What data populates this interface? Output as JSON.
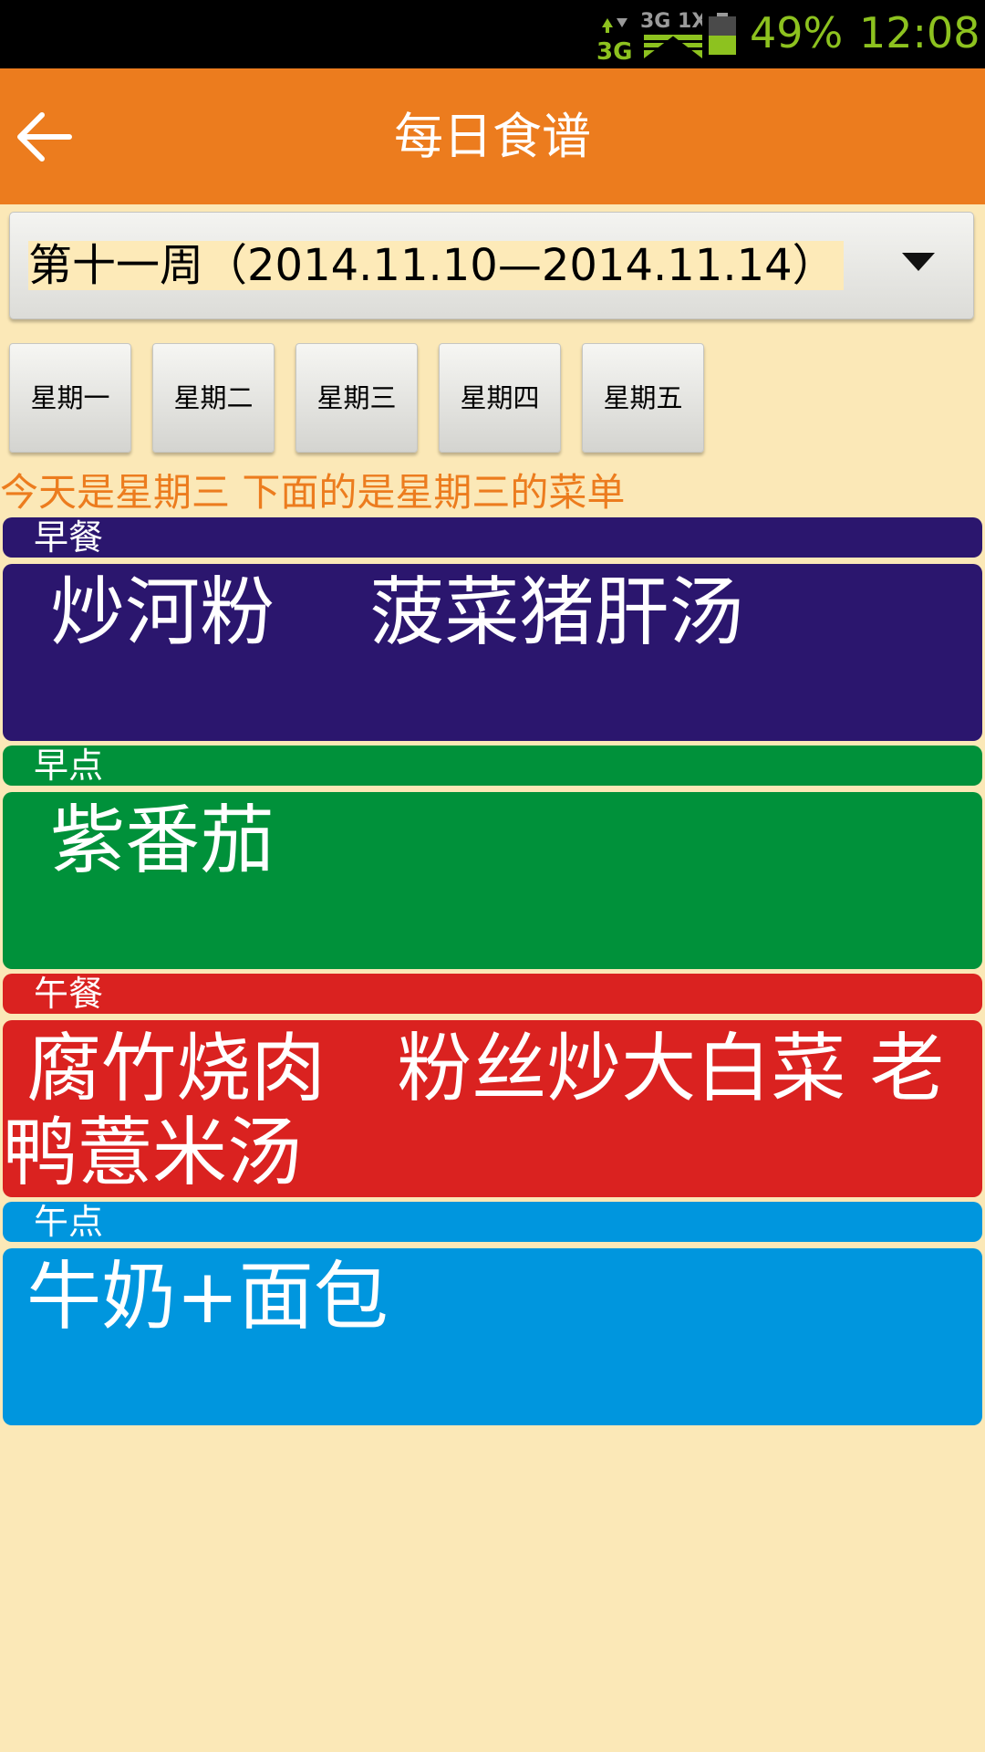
{
  "status_bar": {
    "network_label": "3G",
    "network_label_2": "3G 1X",
    "battery": "49%",
    "time": "12:08",
    "status_color": "#8DC21F"
  },
  "header": {
    "title": "每日食谱",
    "back_icon": "arrow-left-icon",
    "color": "#EC7C1E"
  },
  "week_selector": {
    "value": "第十一周（2014.11.10—2014.11.14）",
    "dropdown_icon": "triangle-down-icon"
  },
  "days": [
    {
      "label": "星期一"
    },
    {
      "label": "星期二"
    },
    {
      "label": "星期三"
    },
    {
      "label": "星期四"
    },
    {
      "label": "星期五"
    }
  ],
  "notice": "今天是星期三  下面的是星期三的菜单",
  "meals": [
    {
      "label": "早餐",
      "content": "  炒河粉    菠菜猪肝汤",
      "color": "#2B166E"
    },
    {
      "label": "早点",
      "content": "  紫番茄",
      "color": "#00913A"
    },
    {
      "label": "午餐",
      "content": " 腐竹烧肉   粉丝炒大白菜 老鸭薏米汤",
      "color": "#DA2220"
    },
    {
      "label": "午点",
      "content": " 牛奶+面包",
      "color": "#0096DE"
    }
  ]
}
